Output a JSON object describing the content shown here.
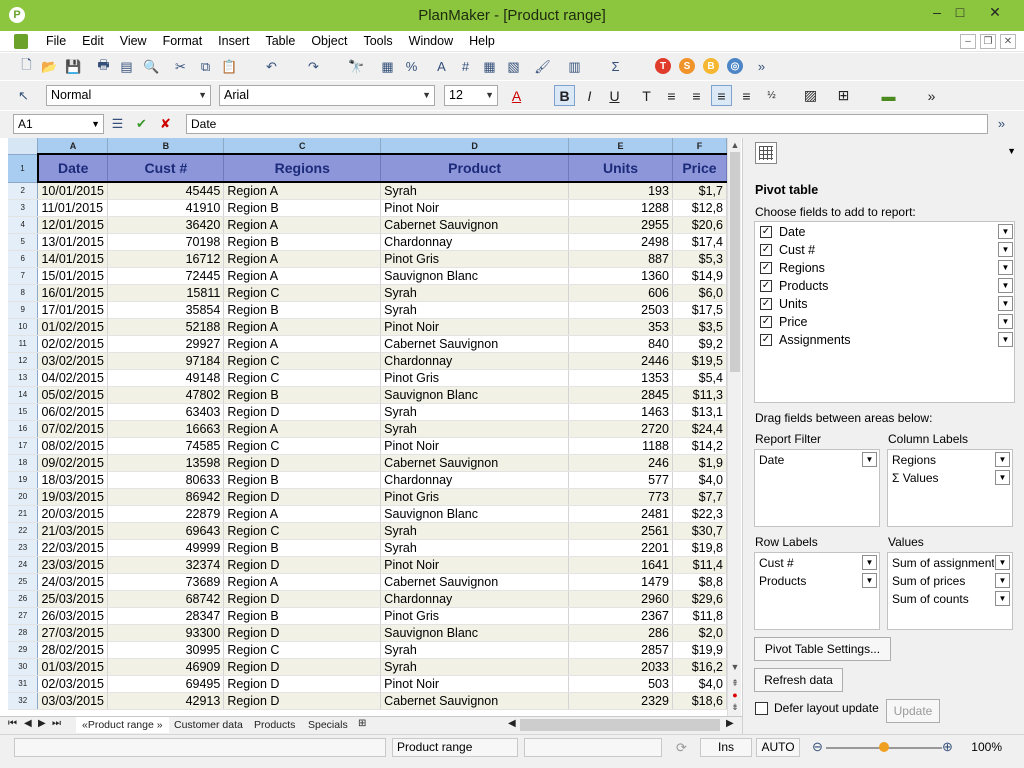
{
  "window": {
    "title": "PlanMaker - [Product range]",
    "app_icon_letter": "P",
    "controls": {
      "minimize": "–",
      "maximize": "□",
      "close": "✕"
    }
  },
  "menu": {
    "items": [
      "File",
      "Edit",
      "View",
      "Format",
      "Insert",
      "Table",
      "Object",
      "Tools",
      "Window",
      "Help"
    ],
    "doc_controls": {
      "minimize": "–",
      "restore": "❐",
      "close": "✕"
    }
  },
  "toolbar": {
    "style_value": "Normal",
    "font_value": "Arial",
    "size_value": "12"
  },
  "formula_bar": {
    "cell_ref": "A1",
    "content": "Date"
  },
  "sheet": {
    "columns": [
      "A",
      "B",
      "C",
      "D",
      "E",
      "F"
    ],
    "header_row": [
      "Date",
      "Cust #",
      "Regions",
      "Product",
      "Units",
      "Price"
    ],
    "rows": [
      [
        "10/01/2015",
        "45445",
        "Region A",
        "Syrah",
        "193",
        "$1,7"
      ],
      [
        "11/01/2015",
        "41910",
        "Region B",
        "Pinot Noir",
        "1288",
        "$12,8"
      ],
      [
        "12/01/2015",
        "36420",
        "Region A",
        "Cabernet Sauvignon",
        "2955",
        "$20,6"
      ],
      [
        "13/01/2015",
        "70198",
        "Region B",
        "Chardonnay",
        "2498",
        "$17,4"
      ],
      [
        "14/01/2015",
        "16712",
        "Region A",
        "Pinot Gris",
        "887",
        "$5,3"
      ],
      [
        "15/01/2015",
        "72445",
        "Region A",
        "Sauvignon Blanc",
        "1360",
        "$14,9"
      ],
      [
        "16/01/2015",
        "15811",
        "Region C",
        "Syrah",
        "606",
        "$6,0"
      ],
      [
        "17/01/2015",
        "35854",
        "Region B",
        "Syrah",
        "2503",
        "$17,5"
      ],
      [
        "01/02/2015",
        "52188",
        "Region A",
        "Pinot Noir",
        "353",
        "$3,5"
      ],
      [
        "02/02/2015",
        "29927",
        "Region A",
        "Cabernet Sauvignon",
        "840",
        "$9,2"
      ],
      [
        "03/02/2015",
        "97184",
        "Region C",
        "Chardonnay",
        "2446",
        "$19,5"
      ],
      [
        "04/02/2015",
        "49148",
        "Region C",
        "Pinot Gris",
        "1353",
        "$5,4"
      ],
      [
        "05/02/2015",
        "47802",
        "Region B",
        "Sauvignon Blanc",
        "2845",
        "$11,3"
      ],
      [
        "06/02/2015",
        "63403",
        "Region D",
        "Syrah",
        "1463",
        "$13,1"
      ],
      [
        "07/02/2015",
        "16663",
        "Region A",
        "Syrah",
        "2720",
        "$24,4"
      ],
      [
        "08/02/2015",
        "74585",
        "Region C",
        "Pinot Noir",
        "1188",
        "$14,2"
      ],
      [
        "09/02/2015",
        "13598",
        "Region D",
        "Cabernet Sauvignon",
        "246",
        "$1,9"
      ],
      [
        "18/03/2015",
        "80633",
        "Region B",
        "Chardonnay",
        "577",
        "$4,0"
      ],
      [
        "19/03/2015",
        "86942",
        "Region D",
        "Pinot Gris",
        "773",
        "$7,7"
      ],
      [
        "20/03/2015",
        "22879",
        "Region A",
        "Sauvignon Blanc",
        "2481",
        "$22,3"
      ],
      [
        "21/03/2015",
        "69643",
        "Region C",
        "Syrah",
        "2561",
        "$30,7"
      ],
      [
        "22/03/2015",
        "49999",
        "Region B",
        "Syrah",
        "2201",
        "$19,8"
      ],
      [
        "23/03/2015",
        "32374",
        "Region D",
        "Pinot Noir",
        "1641",
        "$11,4"
      ],
      [
        "24/03/2015",
        "73689",
        "Region A",
        "Cabernet Sauvignon",
        "1479",
        "$8,8"
      ],
      [
        "25/03/2015",
        "68742",
        "Region D",
        "Chardonnay",
        "2960",
        "$29,6"
      ],
      [
        "26/03/2015",
        "28347",
        "Region B",
        "Pinot Gris",
        "2367",
        "$11,8"
      ],
      [
        "27/03/2015",
        "93300",
        "Region D",
        "Sauvignon Blanc",
        "286",
        "$2,0"
      ],
      [
        "28/02/2015",
        "30995",
        "Region C",
        "Syrah",
        "2857",
        "$19,9"
      ],
      [
        "01/03/2015",
        "46909",
        "Region D",
        "Syrah",
        "2033",
        "$16,2"
      ],
      [
        "02/03/2015",
        "69495",
        "Region D",
        "Pinot Noir",
        "503",
        "$4,0"
      ],
      [
        "03/03/2015",
        "42913",
        "Region D",
        "Cabernet Sauvignon",
        "2329",
        "$18,6"
      ]
    ]
  },
  "sheet_tabs": {
    "tabs": [
      "«Product range »",
      "Customer data",
      "Products",
      "Specials"
    ],
    "active": 0
  },
  "status_bar": {
    "sheet_name": "Product range",
    "mode": "Ins",
    "calc": "AUTO",
    "zoom": "100%",
    "zoom_fraction": 0.5
  },
  "pivot": {
    "title": "Pivot table",
    "choose_label": "Choose fields to add to report:",
    "fields": [
      "Date",
      "Cust #",
      "Regions",
      "Products",
      "Units",
      "Price",
      "Assignments"
    ],
    "drag_label": "Drag fields between areas below:",
    "report_filter": {
      "label": "Report Filter",
      "items": [
        "Date"
      ]
    },
    "column_labels": {
      "label": "Column Labels",
      "items": [
        "Regions",
        "Σ Values"
      ]
    },
    "row_labels": {
      "label": "Row Labels",
      "items": [
        "Cust #",
        "Products"
      ]
    },
    "values": {
      "label": "Values",
      "items": [
        "Sum of assignments",
        "Sum of prices",
        "Sum of counts"
      ]
    },
    "settings_button": "Pivot Table Settings...",
    "refresh_button": "Refresh data",
    "defer_label": "Defer layout update",
    "update_button": "Update"
  },
  "colors": {
    "title_bar": "#8cc63f",
    "header_fill": "#8c96d8",
    "header_text": "#1c2a7a",
    "stripe": "#f1f1e5",
    "column_header": "#a9cdf0"
  }
}
